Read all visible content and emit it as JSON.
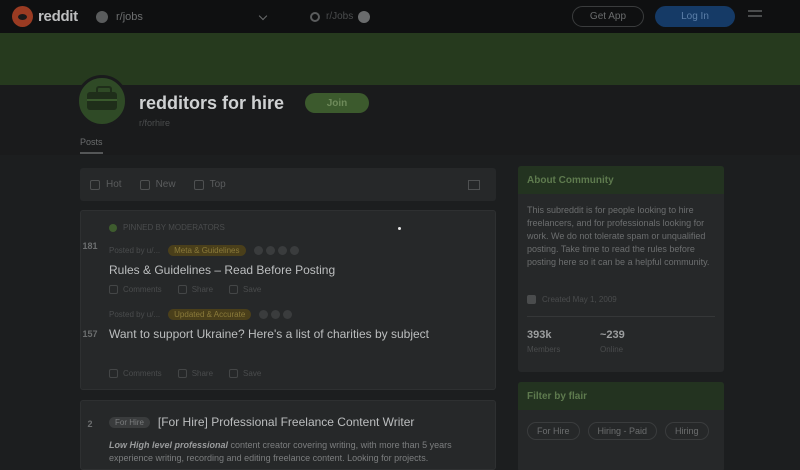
{
  "header": {
    "logo_text": "reddit",
    "home_label": "r/jobs",
    "search_text": "r/Jobs",
    "get_app": "Get App",
    "login": "Log In"
  },
  "community": {
    "name": "redditors for hire",
    "join_label": "Join",
    "sub_name": "r/forhire",
    "tab_posts": "Posts"
  },
  "feed": {
    "sort": [
      "Hot",
      "New",
      "Top"
    ],
    "posts": [
      {
        "pinned_label": "PINNED BY MODERATORS",
        "votes": "181",
        "meta": "Posted by u/...",
        "flair": "Meta & Guidelines",
        "title": "Rules & Guidelines – Read Before Posting",
        "actions": [
          "Comments",
          "Share",
          "Save"
        ]
      },
      {
        "pinned_label": "",
        "votes": "157",
        "meta": "Posted by u/...",
        "flair": "Updated & Accurate",
        "title": "Want to support Ukraine? Here's a list of charities by subject",
        "actions": [
          "Comments",
          "Share",
          "Save"
        ]
      },
      {
        "votes": "2",
        "flair": "For Hire",
        "title": "[For Hire] Professional Freelance Content Writer",
        "body_bold": "Low High level professional",
        "body": " content creator covering writing, with more than 5 years experience writing, recording and editing freelance content. Looking for projects."
      }
    ]
  },
  "sidebar": {
    "about_title": "About Community",
    "about_text": "This subreddit is for people looking to hire freelancers, and for professionals looking for work. We do not tolerate spam or unqualified posting. Take time to read the rules before posting here so it can be a helpful community.",
    "created": "Created May 1, 2009",
    "members": "393k",
    "members_label": "Members",
    "online": "~239",
    "online_label": "Online",
    "filter_title": "Filter by flair",
    "flairs": [
      "For Hire",
      "Hiring - Paid",
      "Hiring"
    ]
  }
}
